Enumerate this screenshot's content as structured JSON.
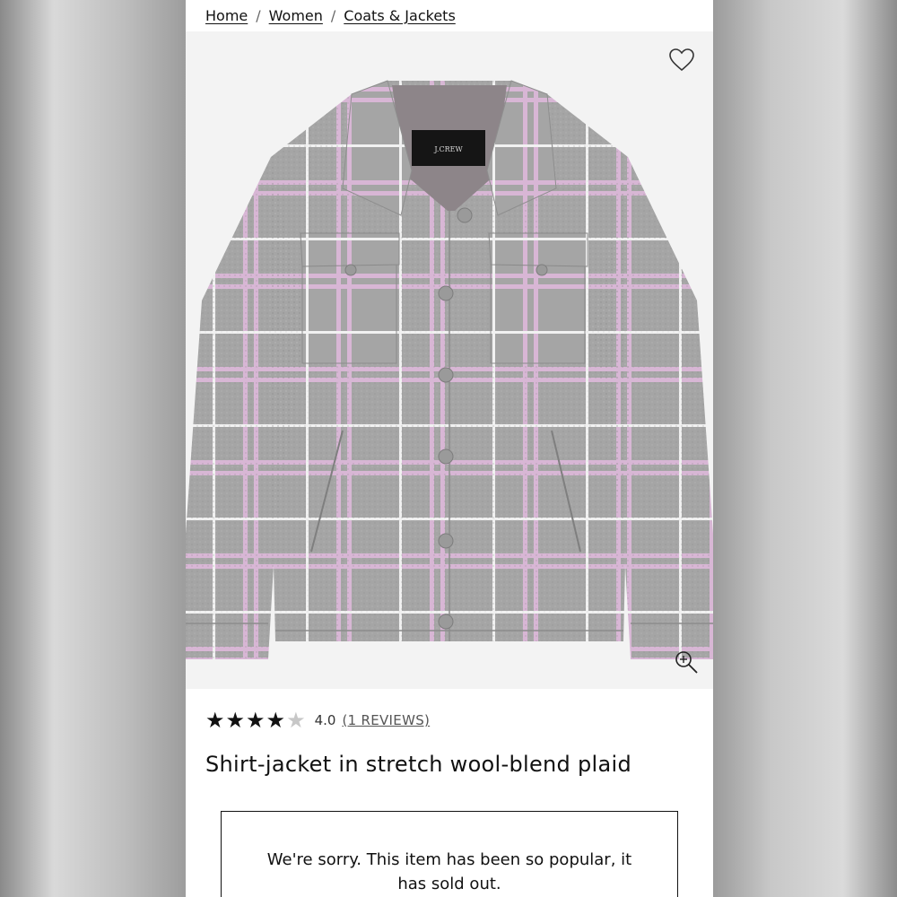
{
  "breadcrumb": {
    "items": [
      "Home",
      "Women",
      "Coats & Jackets"
    ],
    "separator": "/"
  },
  "product": {
    "image_brand_label": "J.CREW",
    "wishlist_icon": "heart-outline-icon",
    "zoom_icon": "zoom-in-icon",
    "rating": {
      "stars_filled": 4,
      "stars_total": 5,
      "value": "4.0",
      "reviews_link": "(1 REVIEWS)"
    },
    "title": "Shirt-jacket in stretch wool-blend plaid",
    "soldout_message": "We're sorry. This item has been so popular, it has sold out."
  },
  "colors": {
    "fabric_gray": "#a3a3a3",
    "plaid_pink": "#d9b7d6",
    "plaid_white": "#f4f4f4",
    "lining": "#8e8689"
  }
}
